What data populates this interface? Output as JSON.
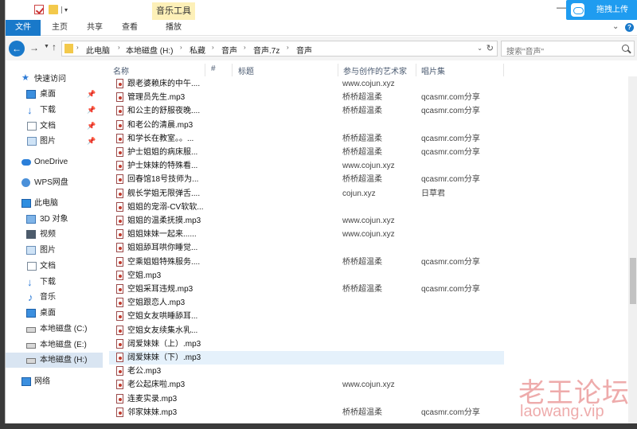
{
  "titlebar": {
    "contextual_tab": "音乐工具",
    "upload_button": "拖拽上传",
    "minimize": "—"
  },
  "ribbon": {
    "tabs": [
      "文件",
      "主页",
      "共享",
      "查看",
      "播放"
    ]
  },
  "address": {
    "breadcrumbs": [
      "此电脑",
      "本地磁盘 (H:)",
      "私藏",
      "音声",
      "音声.7z",
      "音声"
    ]
  },
  "search": {
    "placeholder": "搜索\"音声\""
  },
  "sidebar": {
    "quick_access": "快速访问",
    "items": [
      {
        "label": "桌面",
        "icon": "desktop-icon",
        "pinned": true
      },
      {
        "label": "下载",
        "icon": "download-icon",
        "pinned": true
      },
      {
        "label": "文档",
        "icon": "document-icon",
        "pinned": true
      },
      {
        "label": "图片",
        "icon": "picture-icon",
        "pinned": true
      }
    ],
    "onedrive": "OneDrive",
    "wps": "WPS网盘",
    "this_pc": "此电脑",
    "pc_items": [
      "3D 对象",
      "视频",
      "图片",
      "文档",
      "下载",
      "音乐",
      "桌面",
      "本地磁盘 (C:)",
      "本地磁盘 (E:)",
      "本地磁盘 (H:)"
    ],
    "network": "网络"
  },
  "columns": [
    "名称",
    "#",
    "标题",
    "参与创作的艺术家",
    "唱片集"
  ],
  "files": [
    {
      "name": "跟老婆赖床的中午....",
      "artist": "www.cojun.xyz",
      "album": ""
    },
    {
      "name": "管理员先生.mp3",
      "artist": "桥桥超温柔",
      "album": "qcasmr.com分享"
    },
    {
      "name": "和公主的舒服夜晚....",
      "artist": "桥桥超温柔",
      "album": "qcasmr.com分享"
    },
    {
      "name": "和老公的清晨.mp3",
      "artist": "",
      "album": ""
    },
    {
      "name": "和学长在教室。。...",
      "artist": "桥桥超温柔",
      "album": "qcasmr.com分享"
    },
    {
      "name": "护士姐姐的病床服...",
      "artist": "桥桥超温柔",
      "album": "qcasmr.com分享"
    },
    {
      "name": "护士妹妹的特殊看...",
      "artist": "www.cojun.xyz",
      "album": ""
    },
    {
      "name": "回春馆18号技师为...",
      "artist": "桥桥超温柔",
      "album": "qcasmr.com分享"
    },
    {
      "name": "舰长学姐无限弹舌....",
      "artist": "cojun.xyz",
      "album": "日草君"
    },
    {
      "name": "姐姐的宠溺-CV软软...",
      "artist": "",
      "album": ""
    },
    {
      "name": "姐姐的温柔抚摸.mp3",
      "artist": "www.cojun.xyz",
      "album": ""
    },
    {
      "name": "姐姐妹妹一起来......",
      "artist": "www.cojun.xyz",
      "album": ""
    },
    {
      "name": "姐姐舔耳哄你睡觉...",
      "artist": "",
      "album": ""
    },
    {
      "name": "空乘姐姐特殊服务....",
      "artist": "桥桥超温柔",
      "album": "qcasmr.com分享"
    },
    {
      "name": "空姐.mp3",
      "artist": "",
      "album": ""
    },
    {
      "name": "空姐采耳违规.mp3",
      "artist": "桥桥超温柔",
      "album": "qcasmr.com分享"
    },
    {
      "name": "空姐跟恋人.mp3",
      "artist": "",
      "album": ""
    },
    {
      "name": "空姐女友哄睡舔耳...",
      "artist": "",
      "album": ""
    },
    {
      "name": "空姐女友续集水乳...",
      "artist": "",
      "album": ""
    },
    {
      "name": "阔爱妹妹（上）.mp3",
      "artist": "",
      "album": ""
    },
    {
      "name": "阔爱妹妹（下）.mp3",
      "artist": "",
      "album": ""
    },
    {
      "name": "老公.mp3",
      "artist": "",
      "album": ""
    },
    {
      "name": "老公起床啦.mp3",
      "artist": "www.cojun.xyz",
      "album": ""
    },
    {
      "name": "连麦实录.mp3",
      "artist": "",
      "album": ""
    },
    {
      "name": "邻家妹妹.mp3",
      "artist": "桥桥超温柔",
      "album": "qcasmr.com分享"
    }
  ],
  "selected_index": 20,
  "watermark": {
    "title": "老王论坛",
    "url": "laowang.vip"
  }
}
